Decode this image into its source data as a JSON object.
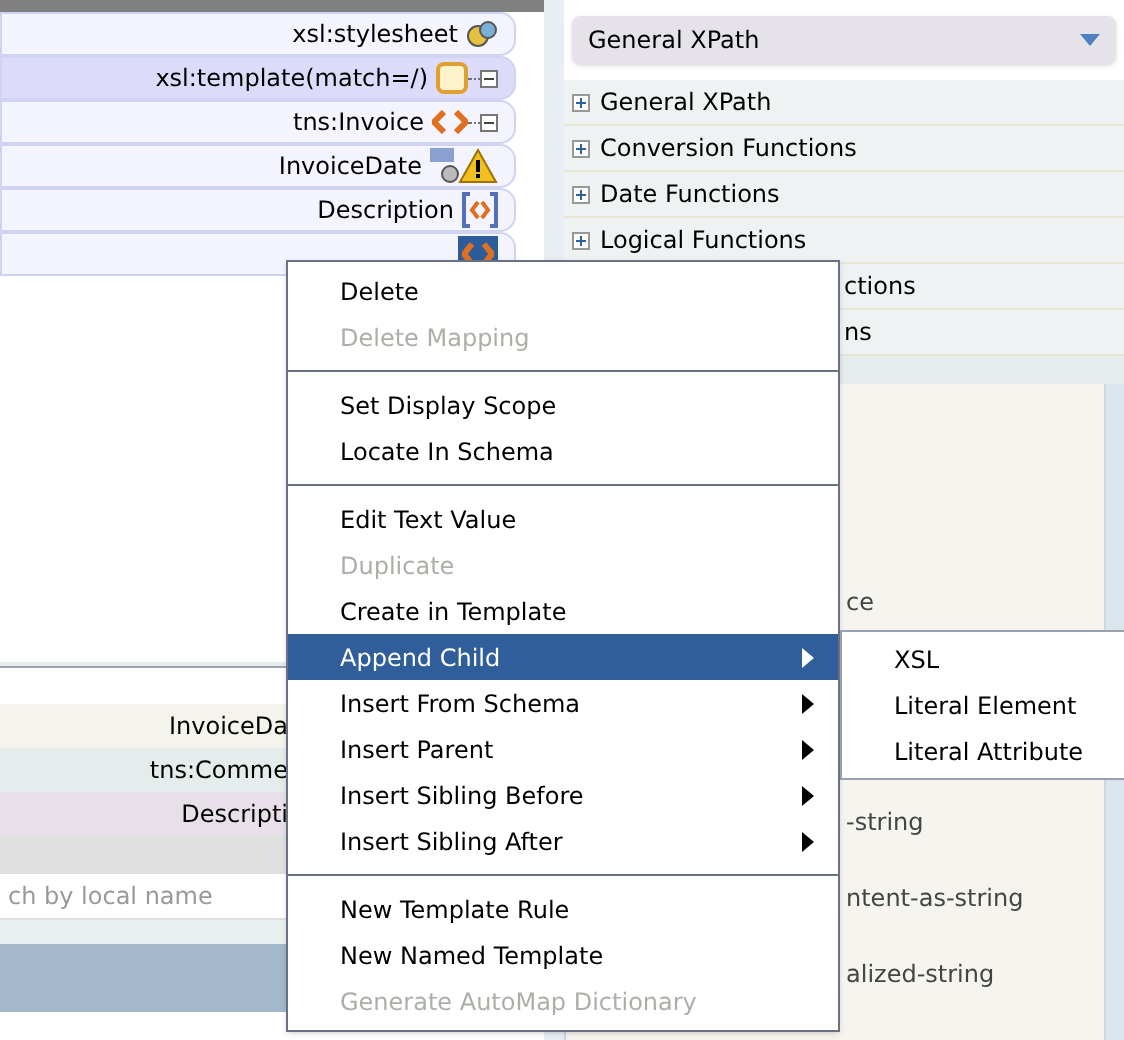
{
  "tree": [
    {
      "label": "xsl:stylesheet",
      "kind": "stylesheet",
      "selected": false
    },
    {
      "label": "xsl:template(match=/)",
      "kind": "template",
      "selected": true
    },
    {
      "label": "tns:Invoice",
      "kind": "element",
      "selected": false
    },
    {
      "label": "InvoiceDate",
      "kind": "warning",
      "selected": false
    },
    {
      "label": "Description",
      "kind": "mapped",
      "selected": false
    },
    {
      "kind": "selected",
      "selected": false
    }
  ],
  "lower_tree": [
    "InvoiceDa",
    "tns:Comme",
    "Descripti"
  ],
  "search": {
    "placeholder": "ch by local name"
  },
  "function_dropdown": {
    "value": "General XPath"
  },
  "function_groups": [
    {
      "label": "General XPath",
      "kind": "group"
    },
    {
      "label": "Conversion Functions",
      "kind": "group"
    },
    {
      "label": "Date Functions",
      "kind": "group"
    },
    {
      "label": "Logical Functions",
      "kind": "group"
    },
    {
      "label": "ctions",
      "kind": "partial"
    },
    {
      "label": "ns",
      "kind": "partial"
    }
  ],
  "function_list": [
    "ce",
    "-string",
    "ntent-as-string",
    "alized-string"
  ],
  "context_menu": [
    {
      "kind": "item",
      "label": "Delete",
      "disabled": false
    },
    {
      "kind": "item",
      "label": "Delete Mapping",
      "disabled": true
    },
    {
      "kind": "separator"
    },
    {
      "kind": "item",
      "label": "Set Display Scope",
      "disabled": false
    },
    {
      "kind": "item",
      "label": "Locate In Schema",
      "disabled": false
    },
    {
      "kind": "separator"
    },
    {
      "kind": "item",
      "label": "Edit Text Value",
      "disabled": false
    },
    {
      "kind": "item",
      "label": "Duplicate",
      "disabled": true
    },
    {
      "kind": "item",
      "label": "Create in Template",
      "disabled": false
    },
    {
      "kind": "submenu",
      "label": "Append Child",
      "disabled": false,
      "selected": true
    },
    {
      "kind": "submenu",
      "label": "Insert From Schema",
      "disabled": false,
      "selected": false
    },
    {
      "kind": "submenu",
      "label": "Insert Parent",
      "disabled": false,
      "selected": false
    },
    {
      "kind": "submenu",
      "label": "Insert Sibling Before",
      "disabled": false,
      "selected": false
    },
    {
      "kind": "submenu",
      "label": "Insert Sibling After",
      "disabled": false,
      "selected": false
    },
    {
      "kind": "separator"
    },
    {
      "kind": "item",
      "label": "New Template Rule",
      "disabled": false
    },
    {
      "kind": "item",
      "label": "New Named Template",
      "disabled": false
    },
    {
      "kind": "item",
      "label": "Generate AutoMap Dictionary",
      "disabled": true
    }
  ],
  "submenu": [
    "XSL",
    "Literal Element",
    "Literal Attribute"
  ]
}
